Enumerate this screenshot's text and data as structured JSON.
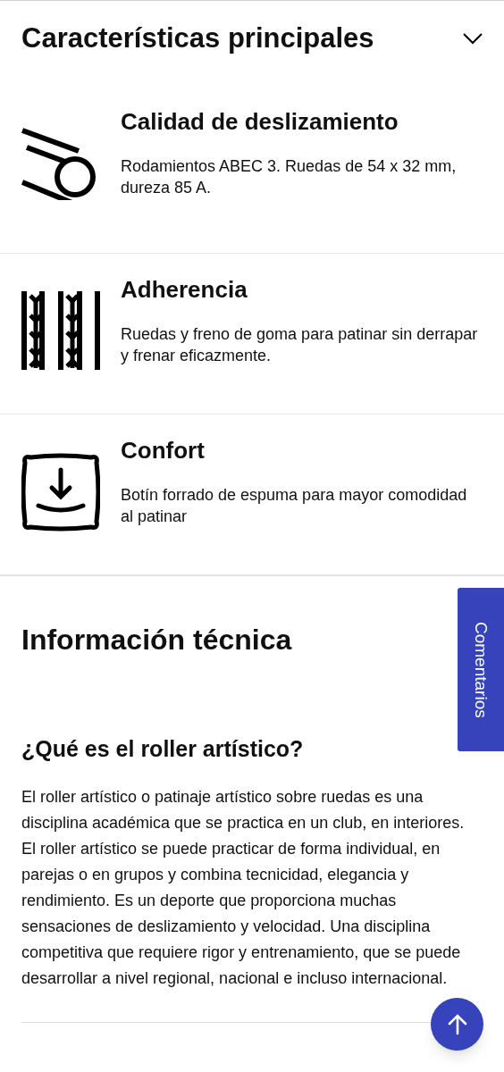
{
  "features_section": {
    "title": "Características principales",
    "expanded": true,
    "items": [
      {
        "title": "Calidad de deslizamiento",
        "text": "Rodamientos ABEC 3. Ruedas de 54 x 32 mm, dureza 85 A."
      },
      {
        "title": "Adherencia",
        "text": "Ruedas y freno de goma para patinar sin derrapar y frenar eficazmente."
      },
      {
        "title": "Confort",
        "text": "Botín forrado de espuma para mayor comodidad al patinar"
      }
    ]
  },
  "technical_section": {
    "title": "Información técnica",
    "subtitle": "¿Qué es el roller artístico?",
    "text": "El roller artístico o patinaje artístico sobre ruedas es una disciplina académica que se practica en un club, en interiores. El roller artístico se puede practicar de forma individual, en parejas o en grupos y combina tecnicidad, elegancia y rendimiento. Es un deporte que proporciona muchas sensaciones de deslizamiento y velocidad. Una disciplina competitiva que requiere rigor y entrenamiento, que se puede desarrollar a nivel regional, nacional e incluso internacional."
  },
  "comments_tab": {
    "label": "Comentarios"
  }
}
